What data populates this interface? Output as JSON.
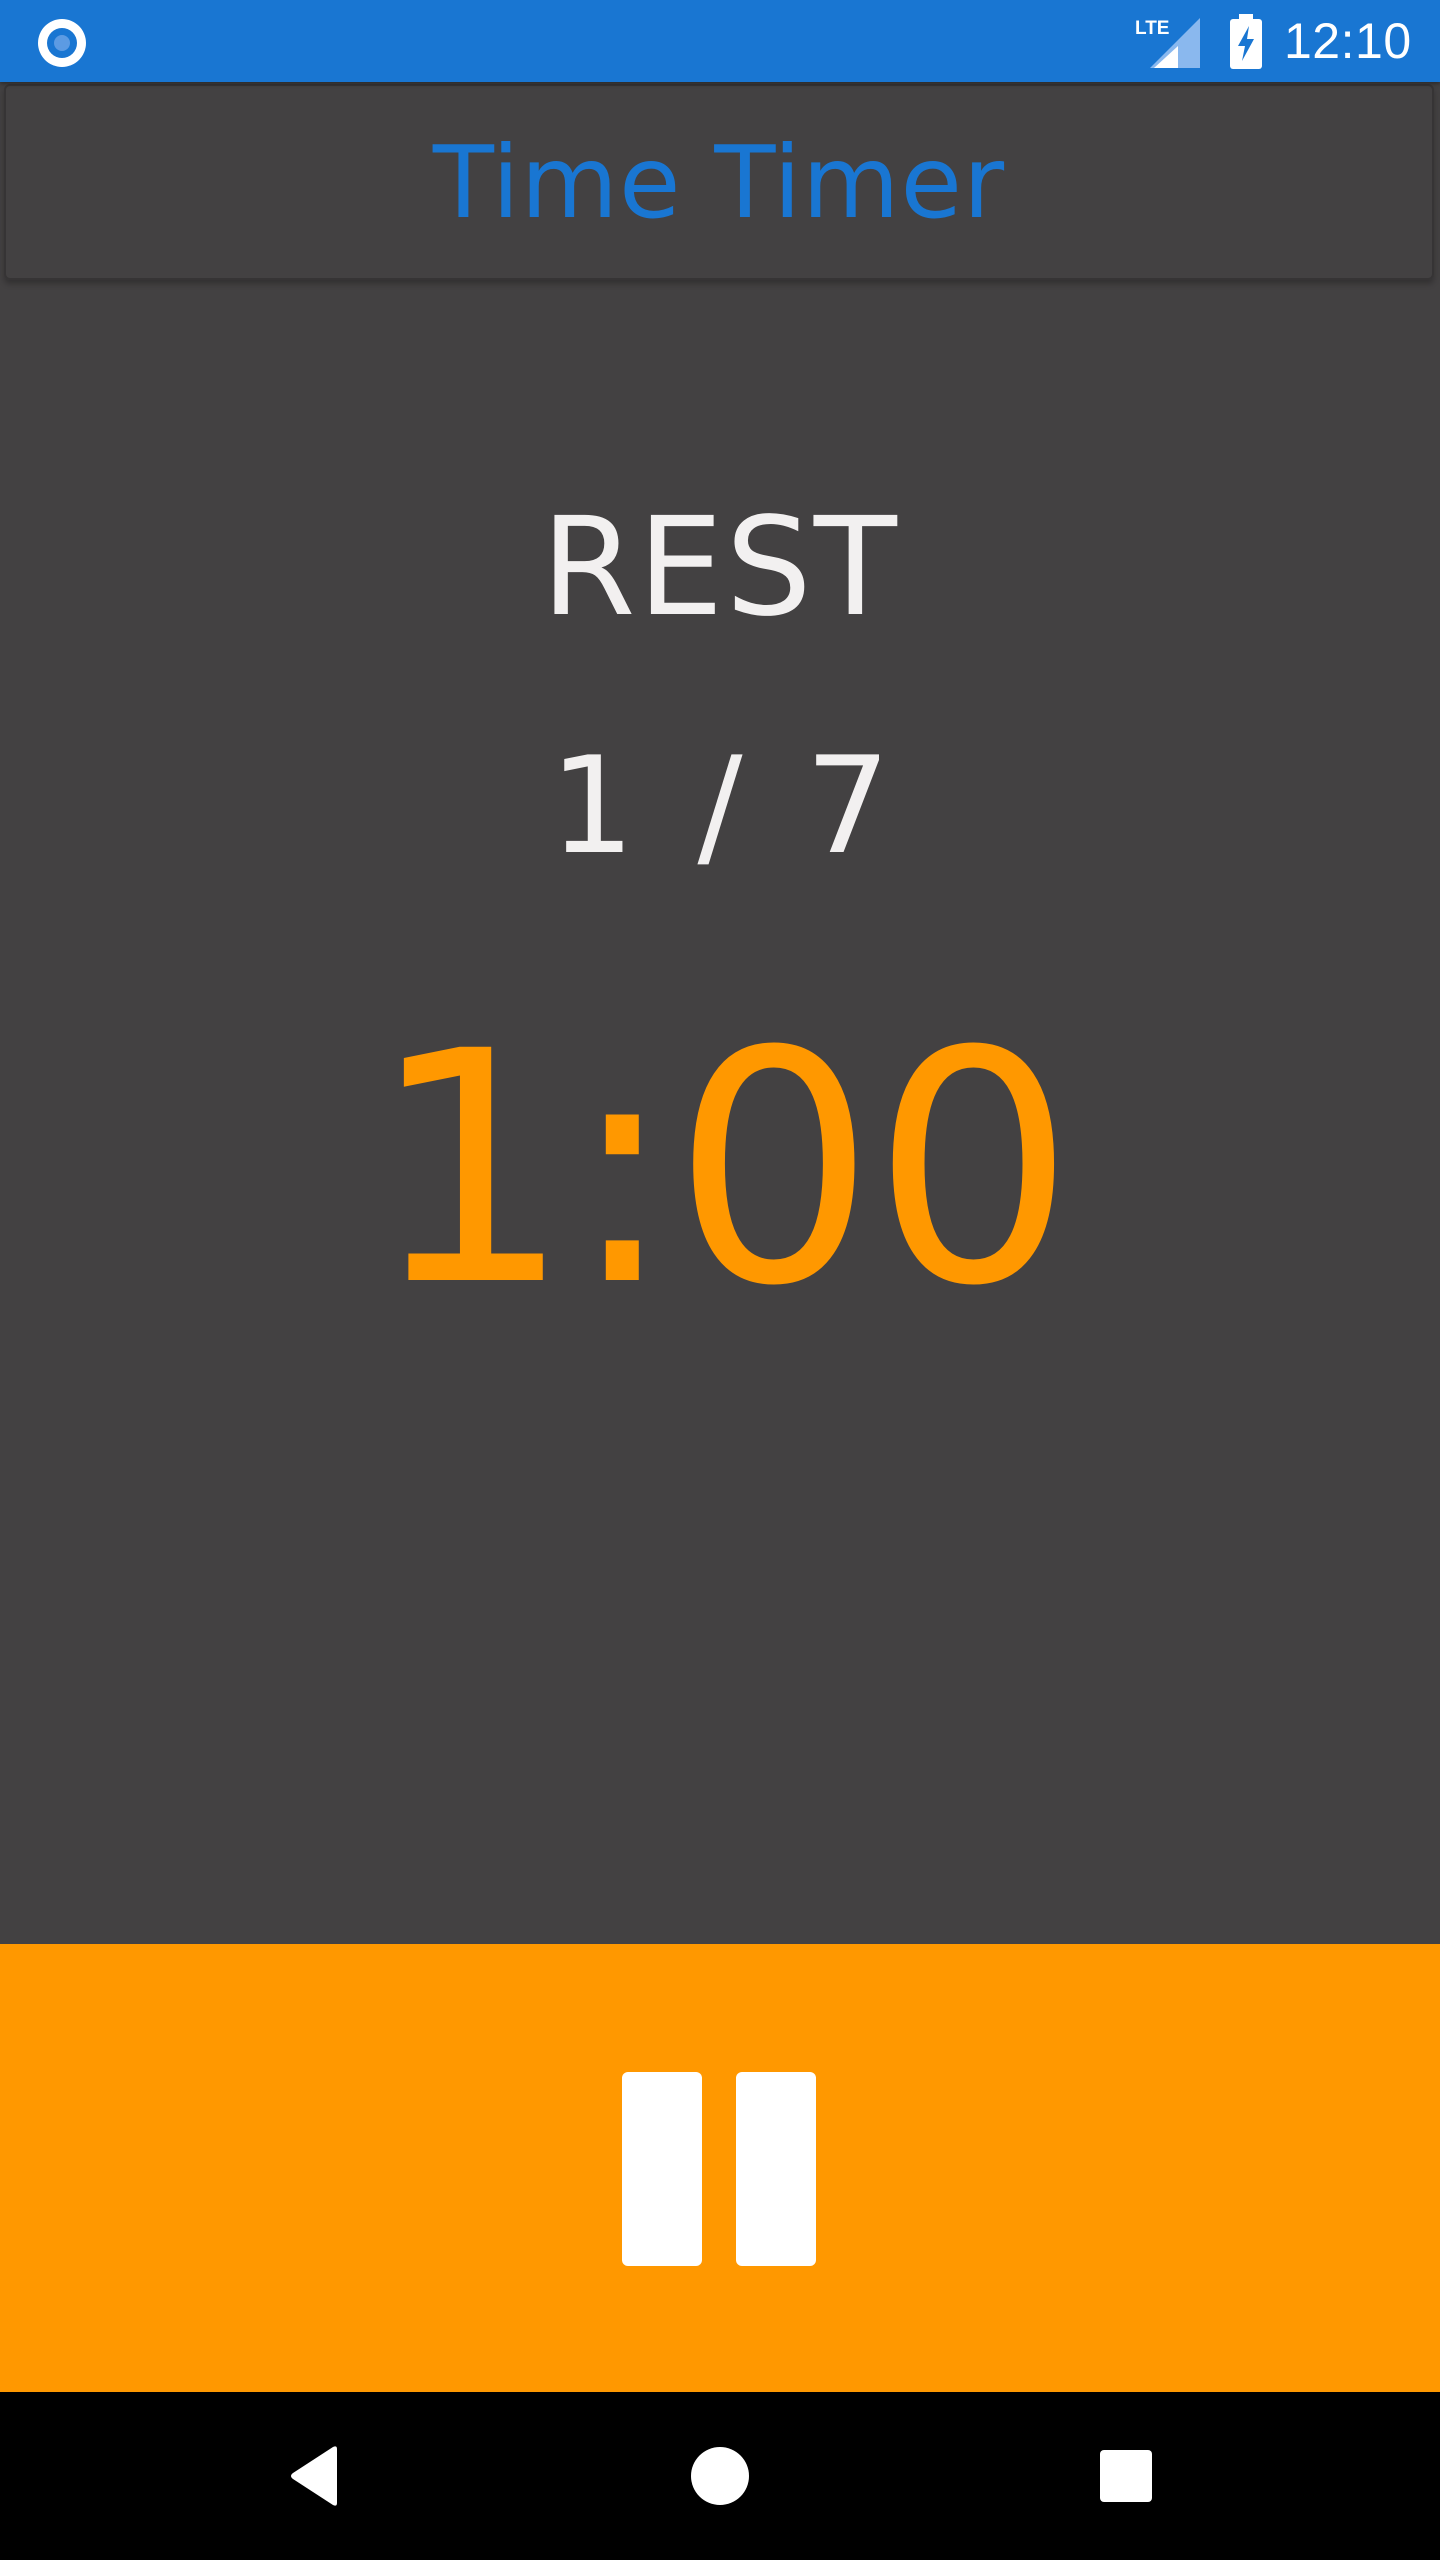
{
  "status_bar": {
    "time": "12:10",
    "network_label": "LTE",
    "icons": [
      "notification-icon",
      "lte-signal-icon",
      "battery-charging-icon"
    ]
  },
  "app_bar": {
    "title": "Time Timer"
  },
  "timer": {
    "phase": "REST",
    "round_current": "1",
    "round_total": "7",
    "round_separator": "/",
    "time_remaining": "1:00"
  },
  "controls": {
    "pause_icon": "pause-icon"
  },
  "nav_bar": {
    "icons": [
      "back-icon",
      "home-icon",
      "recents-icon"
    ]
  },
  "colors": {
    "status_bar": "#1976d2",
    "title": "#1976d2",
    "background": "#434142",
    "accent": "#ff9800",
    "text": "#f2f0f0"
  }
}
